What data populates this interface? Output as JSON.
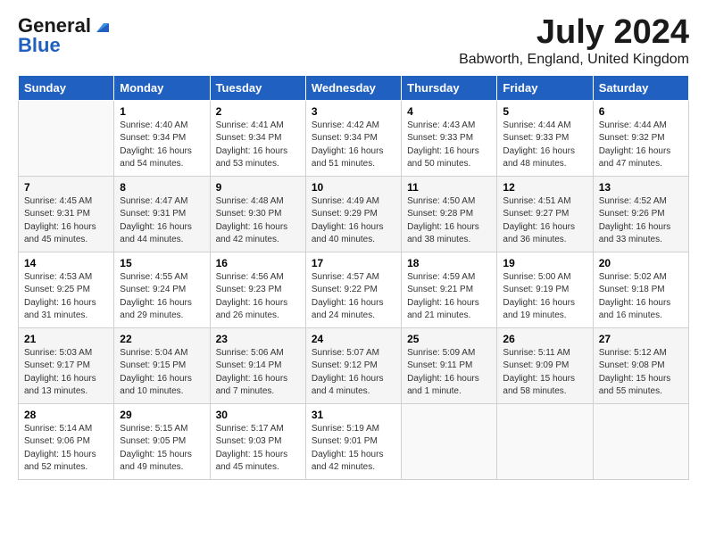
{
  "header": {
    "logo_general": "General",
    "logo_blue": "Blue",
    "main_title": "July 2024",
    "subtitle": "Babworth, England, United Kingdom"
  },
  "calendar": {
    "days_of_week": [
      "Sunday",
      "Monday",
      "Tuesday",
      "Wednesday",
      "Thursday",
      "Friday",
      "Saturday"
    ],
    "weeks": [
      [
        {
          "day": "",
          "sunrise": "",
          "sunset": "",
          "daylight": ""
        },
        {
          "day": "1",
          "sunrise": "Sunrise: 4:40 AM",
          "sunset": "Sunset: 9:34 PM",
          "daylight": "Daylight: 16 hours and 54 minutes."
        },
        {
          "day": "2",
          "sunrise": "Sunrise: 4:41 AM",
          "sunset": "Sunset: 9:34 PM",
          "daylight": "Daylight: 16 hours and 53 minutes."
        },
        {
          "day": "3",
          "sunrise": "Sunrise: 4:42 AM",
          "sunset": "Sunset: 9:34 PM",
          "daylight": "Daylight: 16 hours and 51 minutes."
        },
        {
          "day": "4",
          "sunrise": "Sunrise: 4:43 AM",
          "sunset": "Sunset: 9:33 PM",
          "daylight": "Daylight: 16 hours and 50 minutes."
        },
        {
          "day": "5",
          "sunrise": "Sunrise: 4:44 AM",
          "sunset": "Sunset: 9:33 PM",
          "daylight": "Daylight: 16 hours and 48 minutes."
        },
        {
          "day": "6",
          "sunrise": "Sunrise: 4:44 AM",
          "sunset": "Sunset: 9:32 PM",
          "daylight": "Daylight: 16 hours and 47 minutes."
        }
      ],
      [
        {
          "day": "7",
          "sunrise": "Sunrise: 4:45 AM",
          "sunset": "Sunset: 9:31 PM",
          "daylight": "Daylight: 16 hours and 45 minutes."
        },
        {
          "day": "8",
          "sunrise": "Sunrise: 4:47 AM",
          "sunset": "Sunset: 9:31 PM",
          "daylight": "Daylight: 16 hours and 44 minutes."
        },
        {
          "day": "9",
          "sunrise": "Sunrise: 4:48 AM",
          "sunset": "Sunset: 9:30 PM",
          "daylight": "Daylight: 16 hours and 42 minutes."
        },
        {
          "day": "10",
          "sunrise": "Sunrise: 4:49 AM",
          "sunset": "Sunset: 9:29 PM",
          "daylight": "Daylight: 16 hours and 40 minutes."
        },
        {
          "day": "11",
          "sunrise": "Sunrise: 4:50 AM",
          "sunset": "Sunset: 9:28 PM",
          "daylight": "Daylight: 16 hours and 38 minutes."
        },
        {
          "day": "12",
          "sunrise": "Sunrise: 4:51 AM",
          "sunset": "Sunset: 9:27 PM",
          "daylight": "Daylight: 16 hours and 36 minutes."
        },
        {
          "day": "13",
          "sunrise": "Sunrise: 4:52 AM",
          "sunset": "Sunset: 9:26 PM",
          "daylight": "Daylight: 16 hours and 33 minutes."
        }
      ],
      [
        {
          "day": "14",
          "sunrise": "Sunrise: 4:53 AM",
          "sunset": "Sunset: 9:25 PM",
          "daylight": "Daylight: 16 hours and 31 minutes."
        },
        {
          "day": "15",
          "sunrise": "Sunrise: 4:55 AM",
          "sunset": "Sunset: 9:24 PM",
          "daylight": "Daylight: 16 hours and 29 minutes."
        },
        {
          "day": "16",
          "sunrise": "Sunrise: 4:56 AM",
          "sunset": "Sunset: 9:23 PM",
          "daylight": "Daylight: 16 hours and 26 minutes."
        },
        {
          "day": "17",
          "sunrise": "Sunrise: 4:57 AM",
          "sunset": "Sunset: 9:22 PM",
          "daylight": "Daylight: 16 hours and 24 minutes."
        },
        {
          "day": "18",
          "sunrise": "Sunrise: 4:59 AM",
          "sunset": "Sunset: 9:21 PM",
          "daylight": "Daylight: 16 hours and 21 minutes."
        },
        {
          "day": "19",
          "sunrise": "Sunrise: 5:00 AM",
          "sunset": "Sunset: 9:19 PM",
          "daylight": "Daylight: 16 hours and 19 minutes."
        },
        {
          "day": "20",
          "sunrise": "Sunrise: 5:02 AM",
          "sunset": "Sunset: 9:18 PM",
          "daylight": "Daylight: 16 hours and 16 minutes."
        }
      ],
      [
        {
          "day": "21",
          "sunrise": "Sunrise: 5:03 AM",
          "sunset": "Sunset: 9:17 PM",
          "daylight": "Daylight: 16 hours and 13 minutes."
        },
        {
          "day": "22",
          "sunrise": "Sunrise: 5:04 AM",
          "sunset": "Sunset: 9:15 PM",
          "daylight": "Daylight: 16 hours and 10 minutes."
        },
        {
          "day": "23",
          "sunrise": "Sunrise: 5:06 AM",
          "sunset": "Sunset: 9:14 PM",
          "daylight": "Daylight: 16 hours and 7 minutes."
        },
        {
          "day": "24",
          "sunrise": "Sunrise: 5:07 AM",
          "sunset": "Sunset: 9:12 PM",
          "daylight": "Daylight: 16 hours and 4 minutes."
        },
        {
          "day": "25",
          "sunrise": "Sunrise: 5:09 AM",
          "sunset": "Sunset: 9:11 PM",
          "daylight": "Daylight: 16 hours and 1 minute."
        },
        {
          "day": "26",
          "sunrise": "Sunrise: 5:11 AM",
          "sunset": "Sunset: 9:09 PM",
          "daylight": "Daylight: 15 hours and 58 minutes."
        },
        {
          "day": "27",
          "sunrise": "Sunrise: 5:12 AM",
          "sunset": "Sunset: 9:08 PM",
          "daylight": "Daylight: 15 hours and 55 minutes."
        }
      ],
      [
        {
          "day": "28",
          "sunrise": "Sunrise: 5:14 AM",
          "sunset": "Sunset: 9:06 PM",
          "daylight": "Daylight: 15 hours and 52 minutes."
        },
        {
          "day": "29",
          "sunrise": "Sunrise: 5:15 AM",
          "sunset": "Sunset: 9:05 PM",
          "daylight": "Daylight: 15 hours and 49 minutes."
        },
        {
          "day": "30",
          "sunrise": "Sunrise: 5:17 AM",
          "sunset": "Sunset: 9:03 PM",
          "daylight": "Daylight: 15 hours and 45 minutes."
        },
        {
          "day": "31",
          "sunrise": "Sunrise: 5:19 AM",
          "sunset": "Sunset: 9:01 PM",
          "daylight": "Daylight: 15 hours and 42 minutes."
        },
        {
          "day": "",
          "sunrise": "",
          "sunset": "",
          "daylight": ""
        },
        {
          "day": "",
          "sunrise": "",
          "sunset": "",
          "daylight": ""
        },
        {
          "day": "",
          "sunrise": "",
          "sunset": "",
          "daylight": ""
        }
      ]
    ]
  }
}
